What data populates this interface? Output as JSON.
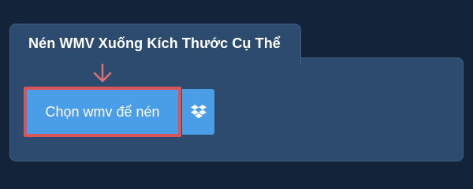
{
  "tab": {
    "title": "Nén WMV Xuống Kích Thước Cụ Thể"
  },
  "upload": {
    "choose_label": "Chọn wmv để nén",
    "dropbox_icon": "dropbox-icon"
  },
  "colors": {
    "page_bg": "#12233a",
    "panel_bg": "#2d4b6e",
    "button_bg": "#4a9ee8",
    "highlight": "#d9555a",
    "arrow": "#e07070"
  }
}
